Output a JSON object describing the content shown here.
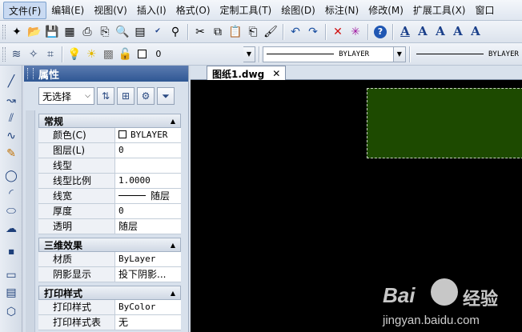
{
  "menubar": {
    "items": [
      "文件(F)",
      "编辑(E)",
      "视图(V)",
      "插入(I)",
      "格式(O)",
      "定制工具(T)",
      "绘图(D)",
      "标注(N)",
      "修改(M)",
      "扩展工具(X)",
      "窗口"
    ]
  },
  "toolbar2": {
    "layer_value": "0",
    "linetype_value": "BYLAYER",
    "lineweight_value": "BYLAYER"
  },
  "properties_panel": {
    "title": "属性",
    "selection_value": "无选择",
    "sections": [
      {
        "title": "常规",
        "rows": [
          {
            "key": "颜色(C)",
            "value": "BYLAYER"
          },
          {
            "key": "图层(L)",
            "value": "0"
          },
          {
            "key": "线型",
            "value": ""
          },
          {
            "key": "线型比例",
            "value": "1.0000"
          },
          {
            "key": "线宽",
            "value": "随层"
          },
          {
            "key": "厚度",
            "value": "0"
          },
          {
            "key": "透明",
            "value": "随层"
          }
        ]
      },
      {
        "title": "三维效果",
        "rows": [
          {
            "key": "材质",
            "value": "ByLayer"
          },
          {
            "key": "阴影显示",
            "value": "投下阴影..."
          }
        ]
      },
      {
        "title": "打印样式",
        "rows": [
          {
            "key": "打印样式",
            "value": "ByColor"
          },
          {
            "key": "打印样式表",
            "value": "无"
          }
        ]
      }
    ]
  },
  "document": {
    "tab_label": "图纸1.dwg",
    "close_glyph": "✕"
  },
  "watermark": {
    "brand": "Bai",
    "brand2": "经验",
    "url": "jingyan.baidu.com"
  },
  "colors": {
    "canvas_bg": "#000000",
    "selected_rect_fill": "#1d4a00",
    "panel_title_bg": "#2f5794"
  }
}
